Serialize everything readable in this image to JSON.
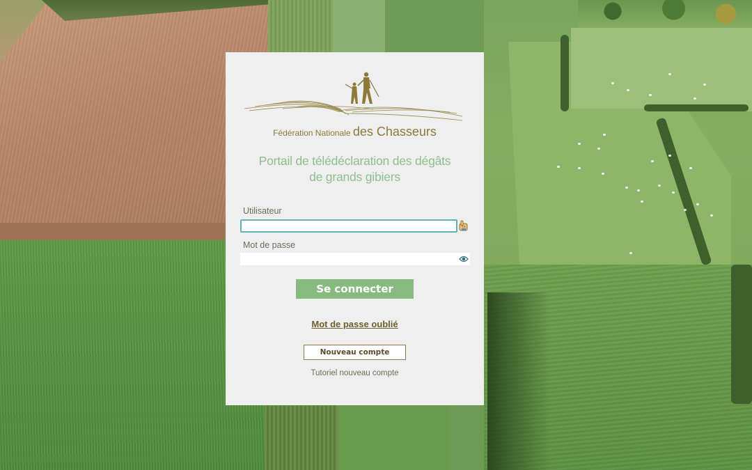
{
  "logo": {
    "name_prefix": "Fédération Nationale",
    "name_main": "des Chasseurs",
    "color": "#8c7a3a"
  },
  "title_line1": "Portail de télédéclaration des dégâts",
  "title_line2": "de grands gibiers",
  "form": {
    "user_label": "Utilisateur",
    "user_value": "",
    "password_label": "Mot de passe",
    "password_value": "",
    "login_button": "Se connecter",
    "forgot_link": "Mot de passe oublié",
    "new_account_button": "Nouveau compte",
    "tutorial_link": "Tutoriel nouveau compte"
  },
  "icons": {
    "user_field_icon": "pointing-hand-icon",
    "password_field_icon": "eye-icon"
  },
  "colors": {
    "title": "#8fbf8e",
    "login_button_bg": "#86ba7f",
    "focus_border": "#5fb1b5"
  }
}
